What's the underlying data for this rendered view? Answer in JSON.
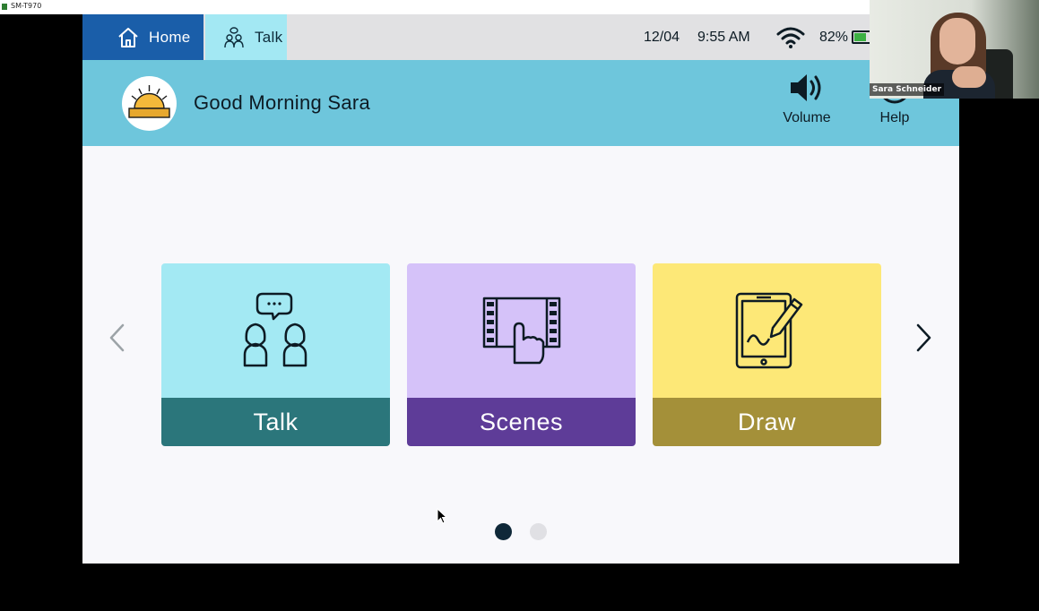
{
  "window": {
    "title": "SM-T970"
  },
  "tabs": [
    {
      "label": "Home",
      "icon": "home-icon"
    },
    {
      "label": "Talk",
      "icon": "talk-people-icon"
    }
  ],
  "status": {
    "date": "12/04",
    "time": "9:55 AM",
    "battery": "82%",
    "battery_level": 0.82
  },
  "header": {
    "greeting": "Good Morning Sara",
    "volume_label": "Volume",
    "help_label": "Help"
  },
  "cards": [
    {
      "label": "Talk",
      "icon": "talk-people-icon",
      "top_color": "#a3e9f3",
      "bottom_color": "#2b767b"
    },
    {
      "label": "Scenes",
      "icon": "scenes-film-icon",
      "top_color": "#d5c2f9",
      "bottom_color": "#5e3c98"
    },
    {
      "label": "Draw",
      "icon": "tablet-pencil-icon",
      "top_color": "#fde877",
      "bottom_color": "#a49039"
    }
  ],
  "pagination": {
    "current": 1,
    "total": 2
  },
  "video": {
    "participant": "Sara Schneider"
  },
  "colors": {
    "home_tab": "#1a5ea9",
    "header": "#6ec6dc",
    "talk_tab": "#a3e8f3"
  }
}
